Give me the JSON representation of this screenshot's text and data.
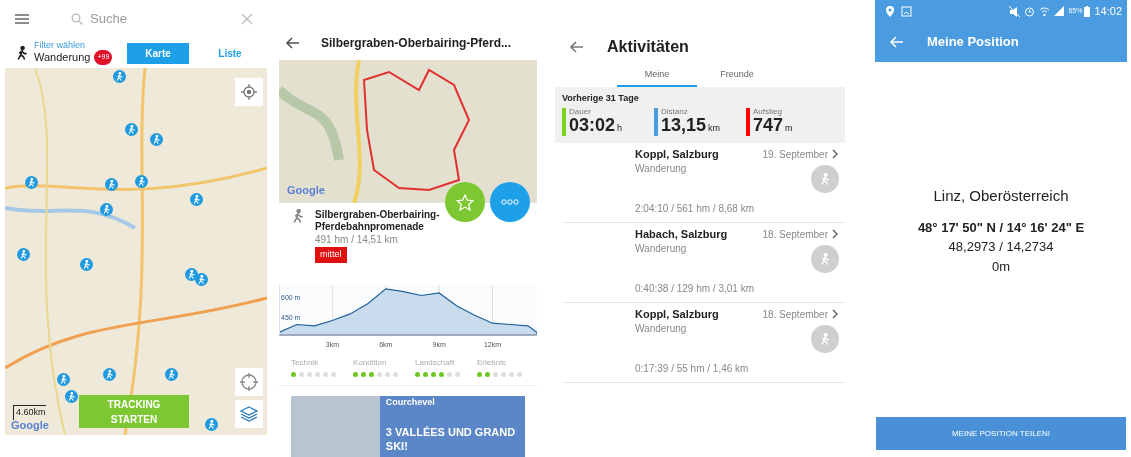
{
  "map_screen": {
    "search": {
      "placeholder": "Suche"
    },
    "filter": {
      "label": "Filter wählen",
      "activity": "Wanderung",
      "badge": "+99"
    },
    "tabs": [
      {
        "label": "Karte",
        "selected": true
      },
      {
        "label": "Liste",
        "selected": false
      }
    ],
    "map": {
      "scale": "4.60km",
      "attribution": "Google"
    },
    "tracking_button": "TRACKING STARTEN"
  },
  "route_screen": {
    "title": "Silbergraben-Oberbairing-Pferd...",
    "map": {
      "attribution": "Google"
    },
    "route": {
      "name": "Silbergraben-Oberbairing-Pferdebahnpromenade",
      "stats": "491 hm / 14,51 km",
      "difficulty": "mittel"
    },
    "elevation": {
      "chart_data": {
        "type": "area",
        "x": [
          0,
          1,
          2,
          3,
          4,
          5,
          6,
          7,
          8,
          9,
          10,
          11,
          12,
          13,
          14,
          14.5
        ],
        "series": [
          {
            "color": "#1f5f99",
            "values": [
              340,
              400,
              390,
              430,
              480,
              560,
              670,
              650,
              620,
              640,
              540,
              470,
              410,
              400,
              390,
              340
            ]
          }
        ],
        "xlim": [
          0,
          14.5
        ],
        "ylim": [
          320,
          700
        ],
        "grid": true,
        "xticks": [
          {
            "value": 3,
            "label": "3km"
          },
          {
            "value": 6,
            "label": "6km"
          },
          {
            "value": 9,
            "label": "9km"
          },
          {
            "value": 12,
            "label": "12km"
          }
        ],
        "yticks": [
          {
            "value": 450,
            "label": "450 m"
          },
          {
            "value": 600,
            "label": "600 m"
          }
        ]
      }
    },
    "ratings": [
      {
        "label": "Technik",
        "stars": 1
      },
      {
        "label": "Kondition",
        "stars": 3
      },
      {
        "label": "Landschaft",
        "stars": 4
      },
      {
        "label": "Erlebnis",
        "stars": 2
      }
    ],
    "ad": {
      "location": "Courchevel",
      "headline": "3 VALLÉES UND GRAND SKI!"
    }
  },
  "activities_screen": {
    "title": "Aktivitäten",
    "tabs": [
      {
        "label": "Meine",
        "selected": true
      },
      {
        "label": "Freunde",
        "selected": false
      }
    ],
    "summary": {
      "period": "Vorherige 31 Tage",
      "stats": [
        {
          "label": "Dauer",
          "value": "03:02",
          "unit": "h",
          "color": "#7ed321"
        },
        {
          "label": "Distanz",
          "value": "13,15",
          "unit": "km",
          "color": "#4a9be0"
        },
        {
          "label": "Aufstieg",
          "value": "747",
          "unit": "m",
          "color": "#ff0000"
        }
      ]
    },
    "items": [
      {
        "title": "Koppl, Salzburg",
        "date": "19. September",
        "type": "Wanderung",
        "stats": "2:04:10 / 561 hm / 8,68 km"
      },
      {
        "title": "Habach, Salzburg",
        "date": "18. September",
        "type": "Wanderung",
        "stats": "0:40:38 / 129 hm / 3,01 km"
      },
      {
        "title": "Koppl, Salzburg",
        "date": "18. September",
        "type": "Wanderung",
        "stats": "0:17:39 / 55 hm / 1,46 km"
      }
    ]
  },
  "position_screen": {
    "status_bar": {
      "battery": "65%",
      "time": "14:02"
    },
    "title": "Meine Position",
    "place": "Linz, Oberösterreich",
    "coordinates_dms": "48° 17' 50\" N / 14° 16' 24\" E",
    "coordinates_decimal": "48,2973 / 14,2734",
    "altitude": "0m",
    "share_button": "MEINE POSITION TEILEN!"
  }
}
